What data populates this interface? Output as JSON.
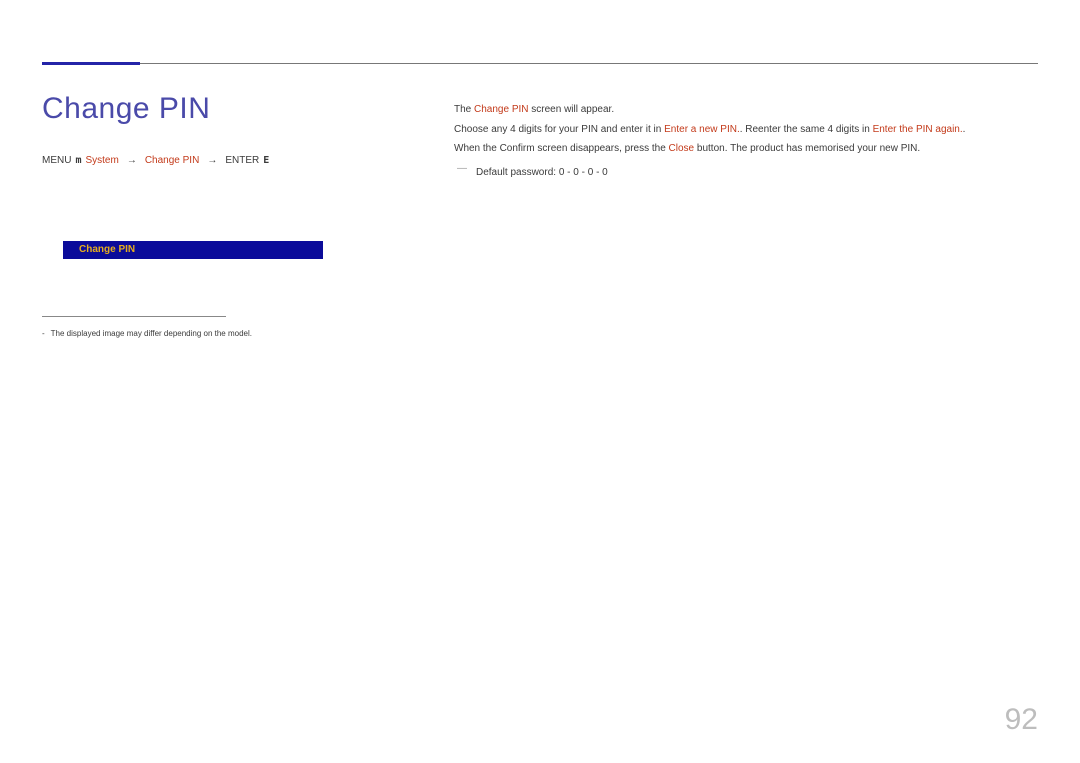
{
  "heading": "Change  PIN",
  "breadcrumb": {
    "menu": "MENU",
    "menu_glyph": "m",
    "system": "System",
    "arrow1": "→",
    "change_pin": "Change PIN",
    "arrow2": "→",
    "enter": "ENTER",
    "enter_glyph": "E"
  },
  "menu_box_label": "Change PIN",
  "footnote_dash": "-",
  "footnote_text": "The displayed image may differ depending on the model.",
  "right": {
    "l1a": "The ",
    "l1b": "Change PIN",
    "l1c": " screen will appear.",
    "l2a": "Choose any 4 digits for your PIN and enter it in ",
    "l2b": "Enter a new PIN.",
    "l2c": ". Reenter the same 4 digits in ",
    "l2d": "Enter the PIN again.",
    "l2e": ".",
    "l3a": "When the Confirm screen disappears, press the ",
    "l3b": "Close",
    "l3c": " button. The product has memorised your new PIN.",
    "note_dash": "―",
    "note_a": "Default password: 0",
    "note_b": " - 0",
    "note_c": " - 0",
    "note_d": " - 0"
  },
  "page_number": "92"
}
